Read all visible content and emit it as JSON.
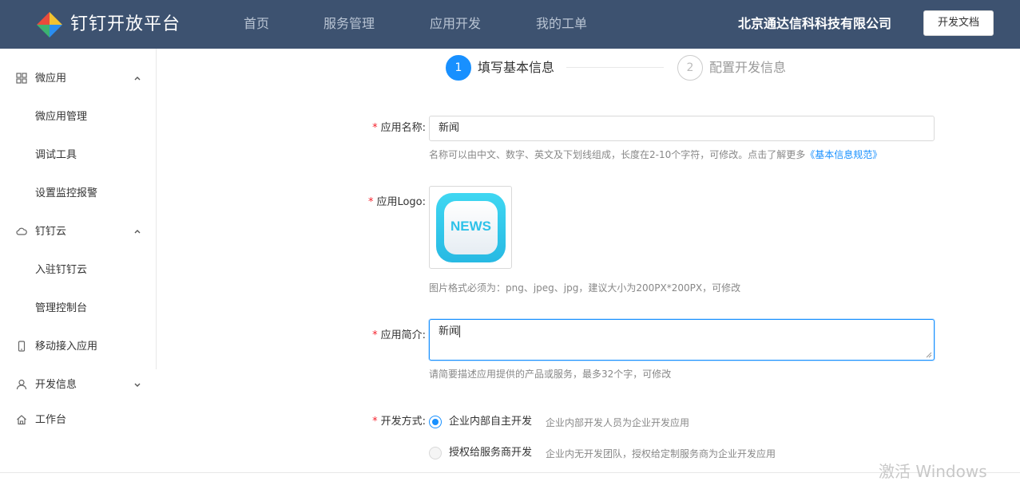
{
  "header": {
    "brand": "钉钉开放平台",
    "nav": [
      "首页",
      "服务管理",
      "应用开发",
      "我的工单"
    ],
    "company": "北京通达信科科技有限公司",
    "doc_button": "开发文档",
    "bg_color": "#3d5270"
  },
  "sidebar": {
    "items": [
      {
        "label": "微应用",
        "icon": "grid-icon",
        "expanded": true
      },
      {
        "label": "微应用管理"
      },
      {
        "label": "调试工具"
      },
      {
        "label": "设置监控报警"
      },
      {
        "label": "钉钉云",
        "icon": "cloud-icon",
        "expanded": true
      },
      {
        "label": "入驻钉钉云"
      },
      {
        "label": "管理控制台"
      },
      {
        "label": "移动接入应用",
        "icon": "mobile-icon"
      },
      {
        "label": "开发信息",
        "icon": "user-icon",
        "expanded": false
      },
      {
        "label": "工作台",
        "icon": "home-icon"
      }
    ]
  },
  "steps": [
    {
      "number": "1",
      "label": "填写基本信息",
      "active": true
    },
    {
      "number": "2",
      "label": "配置开发信息",
      "active": false
    }
  ],
  "form": {
    "name": {
      "label": "应用名称:",
      "value": "新闻",
      "hint": "名称可以由中文、数字、英文及下划线组成，长度在2-10个字符，可修改。点击了解更多",
      "hint_link": "《基本信息规范》"
    },
    "logo": {
      "label": "应用Logo:",
      "image_text": "NEWS",
      "hint": "图片格式必须为：png、jpeg、jpg，建议大小为200PX*200PX，可修改"
    },
    "intro": {
      "label": "应用简介:",
      "value": "新闻",
      "hint": "请简要描述应用提供的产品或服务，最多32个字，可修改"
    },
    "dev_mode": {
      "label": "开发方式:",
      "options": [
        {
          "label": "企业内部自主开发",
          "desc": "企业内部开发人员为企业开发应用",
          "selected": true
        },
        {
          "label": "授权给服务商开发",
          "desc": "企业内无开发团队，授权给定制服务商为企业开发应用",
          "selected": false
        }
      ]
    },
    "required_mark": "*"
  },
  "watermark": "激活 Windows",
  "accent_color": "#1890ff"
}
